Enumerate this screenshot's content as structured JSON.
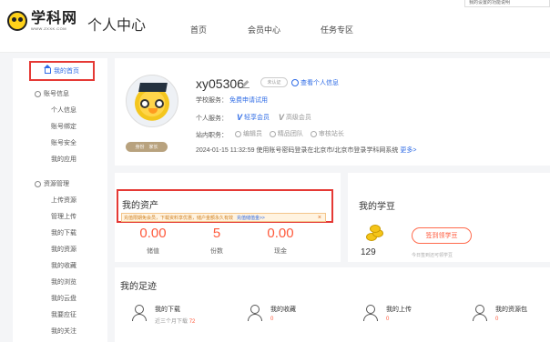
{
  "header": {
    "logo_name": "学科网",
    "logo_url": "WWW.ZXXK.COM",
    "page_title": "个人中心",
    "nav": [
      "首页",
      "会员中心",
      "任务专区"
    ],
    "tooltip_text": "我的设置的功能说明"
  },
  "sidebar": {
    "home": "我的首页",
    "account_group": "账号信息",
    "account_items": [
      "个人信息",
      "账号绑定",
      "账号安全",
      "我的应用"
    ],
    "resource_group": "资源管理",
    "resource_items": [
      "上传资源",
      "管理上传",
      "我的下载",
      "我的资源",
      "我的收藏",
      "我的浏览",
      "我的云盘",
      "我要应征",
      "我的关注"
    ]
  },
  "profile": {
    "username": "xy05306",
    "uid_badge": "未认证",
    "view_info": "查看个人信息",
    "school_label": "学校服务：",
    "school_value": "免费申请试用",
    "personal_label": "个人服务：",
    "vip1": "轻享会员",
    "vip2": "高级会员",
    "position_label": "站内职务：",
    "positions": [
      "编辑员",
      "精品团队",
      "审核站长"
    ],
    "login_text": "2024-01-15 11:32:59 使用账号密码登录在北京市/北京市登录学科网系统",
    "login_more": "更多>",
    "role_tag_a": "身份",
    "role_tag_b": "家长"
  },
  "assets": {
    "title": "我的资产",
    "notice": "充值限期免会员，下载资料享优惠，储户金额永久有效",
    "notice_link": "充值储值金>>",
    "notice_close": "×",
    "stats": [
      {
        "value": "0.00",
        "label": "储值"
      },
      {
        "value": "5",
        "label": "份数"
      },
      {
        "value": "0.00",
        "label": "现金"
      }
    ]
  },
  "beans": {
    "title": "我的学豆",
    "value": "129",
    "button": "签到领学豆",
    "note": "今日签到还可领学豆"
  },
  "footprint": {
    "title": "我的足迹",
    "cards": [
      {
        "label": "我的下载",
        "sub": "近三个月下载",
        "num": "72"
      },
      {
        "label": "我的收藏",
        "sub": "",
        "num": "0"
      },
      {
        "label": "我的上传",
        "sub": "",
        "num": "0"
      },
      {
        "label": "我的资源包",
        "sub": "",
        "num": "0"
      }
    ]
  },
  "colors": {
    "accent": "#2e6be6",
    "highlight": "#ff5a3c",
    "annotation": "#e53935"
  }
}
